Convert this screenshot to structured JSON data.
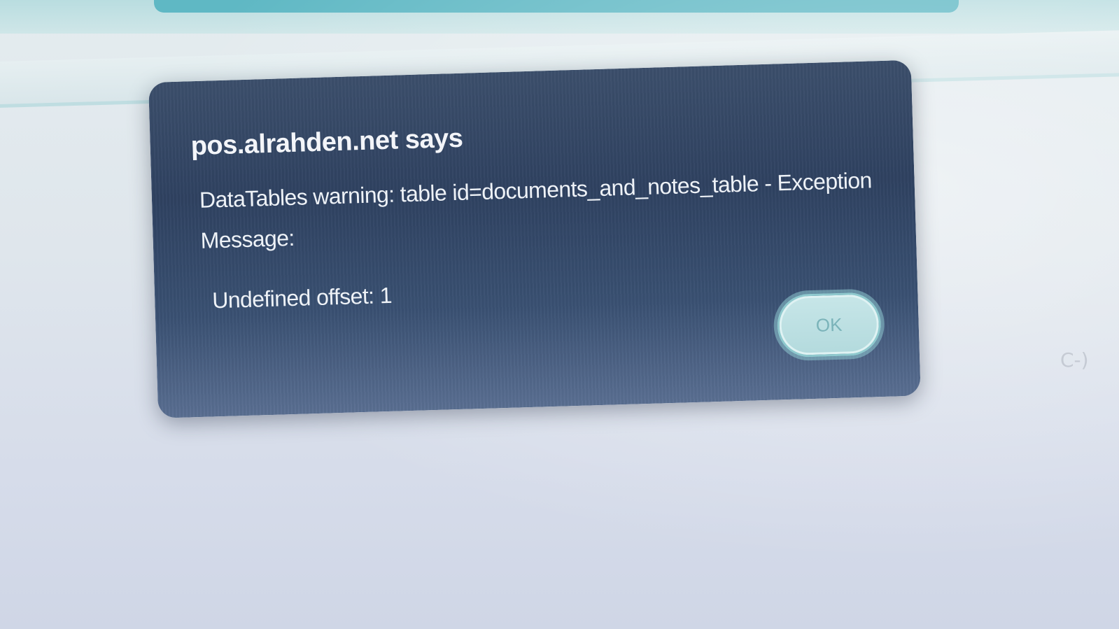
{
  "browser_dialog": {
    "title": "pos.alrahden.net says",
    "message_lines": [
      "DataTables warning: table id=documents_and_notes_table - Exception",
      "Message:",
      "Undefined offset: 1"
    ],
    "ok_label": "OK"
  },
  "page": {
    "side_glyph": "C-)"
  },
  "colors": {
    "dialog_background": "#32455f",
    "ok_button_background": "#c7e6e8",
    "nav_accent": "#5fb8c4"
  }
}
